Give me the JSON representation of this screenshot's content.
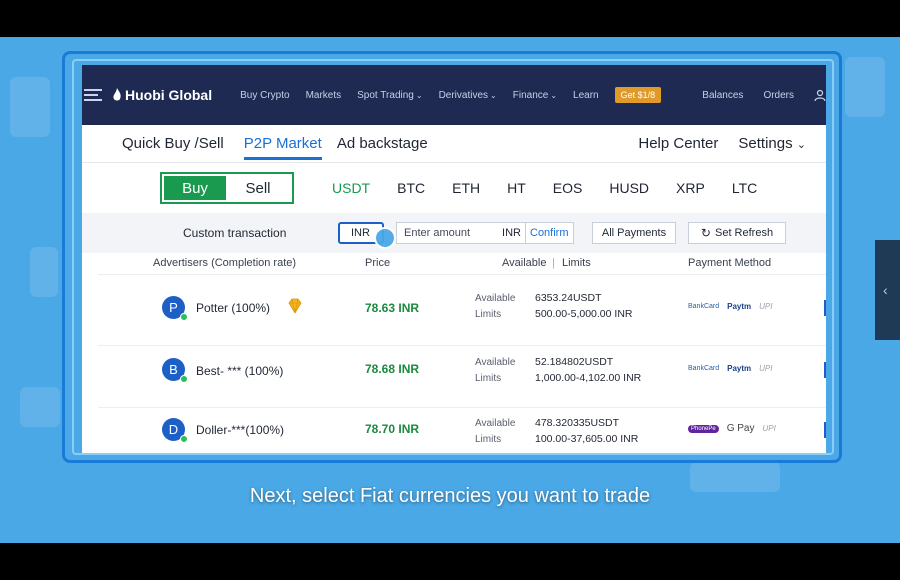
{
  "brand": {
    "name": "Huobi Global"
  },
  "topnav": {
    "items": [
      {
        "label": "Buy Crypto",
        "chevron": false
      },
      {
        "label": "Markets",
        "chevron": false
      },
      {
        "label": "Spot Trading",
        "chevron": true
      },
      {
        "label": "Derivatives",
        "chevron": true
      },
      {
        "label": "Finance",
        "chevron": true
      },
      {
        "label": "Learn",
        "chevron": false
      }
    ],
    "promo_label": "Get $1/8",
    "balances_label": "Balances",
    "orders_label": "Orders"
  },
  "subnav": {
    "quick_buy": "Quick Buy /Sell",
    "p2p_market": "P2P Market",
    "ad_backstage": "Ad backstage",
    "help_center": "Help Center",
    "settings": "Settings"
  },
  "trade": {
    "buy_label": "Buy",
    "sell_label": "Sell",
    "coins": [
      "USDT",
      "BTC",
      "ETH",
      "HT",
      "EOS",
      "HUSD",
      "XRP",
      "LTC"
    ],
    "active_coin": "USDT"
  },
  "filter": {
    "label": "Custom transaction",
    "fiat_value": "INR",
    "amount_placeholder": "Enter amount",
    "amount_currency": "INR",
    "confirm_label": "Confirm",
    "payments_label": "All Payments",
    "refresh_label": "Set Refresh"
  },
  "table": {
    "headers": {
      "advertisers": "Advertisers (Completion rate)",
      "price": "Price",
      "available": "Available",
      "limits": "Limits",
      "payment_method": "Payment Method"
    },
    "available_label": "Available",
    "limits_label": "Limits",
    "rows": [
      {
        "initial": "P",
        "name": "Potter (100%)",
        "price": "78.63 INR",
        "available": "6353.24USDT",
        "limits": "500.00-5,000.00 INR",
        "payments": [
          "BankCard",
          "Paytm",
          "UPI"
        ]
      },
      {
        "initial": "B",
        "name": "Best- *** (100%)",
        "price": "78.68 INR",
        "available": "52.184802USDT",
        "limits": "1,000.00-4,102.00 INR",
        "payments": [
          "BankCard",
          "Paytm",
          "UPI"
        ]
      },
      {
        "initial": "D",
        "name": "Doller-***(100%)",
        "price": "78.70 INR",
        "available": "478.320335USDT",
        "limits": "100.00-37,605.00 INR",
        "payments": [
          "PhonePe",
          "G Pay",
          "UPI"
        ]
      }
    ]
  },
  "caption": "Next, select Fiat currencies you want to trade",
  "colors": {
    "nav_bg": "#1f2a52",
    "accent_blue": "#1b6fd6",
    "buy_green": "#1a9a4e",
    "price_green": "#1a8a3e",
    "stage_bg": "#4aa8e6"
  }
}
